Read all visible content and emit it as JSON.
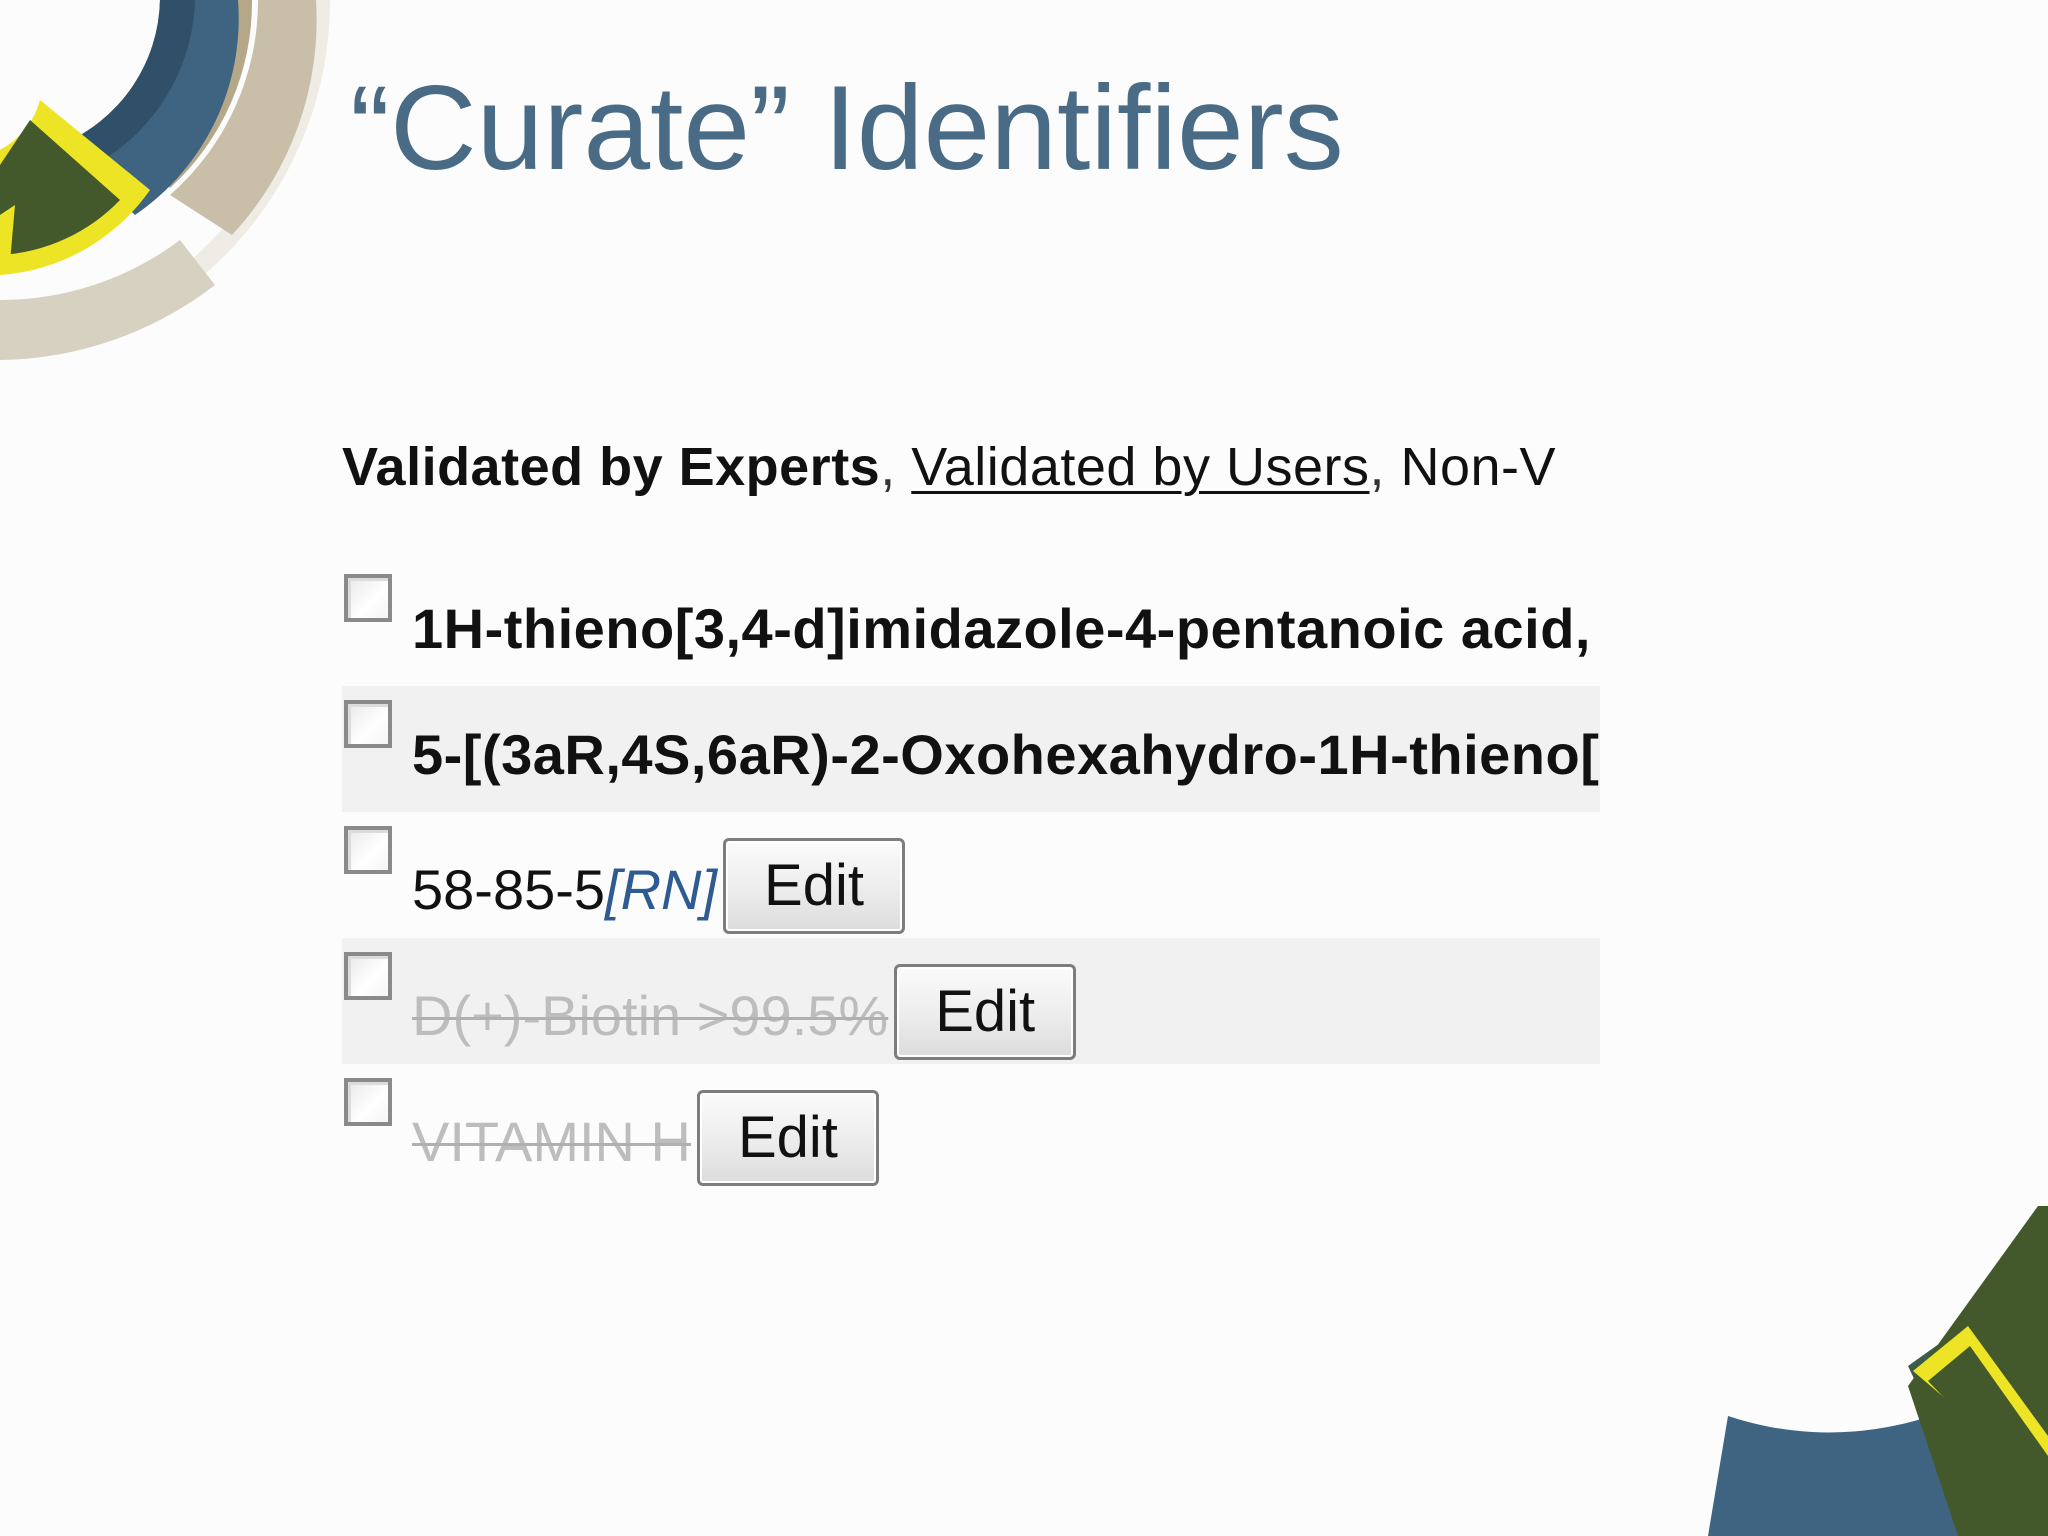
{
  "slide": {
    "title": "“Curate” Identifiers"
  },
  "filters": {
    "experts": "Validated by Experts",
    "sep1": ",",
    "users": "Validated by Users",
    "sep2": ",",
    "non_validated": "Non-V"
  },
  "identifiers": [
    {
      "text": "1H-thieno[3,4-d]imidazole-4-pentanoic acid,",
      "checked": false
    },
    {
      "text": "5-[(3aR,4S,6aR)-2-Oxohexahydro-1H-thieno[",
      "checked": false
    },
    {
      "text": "58-85-5",
      "tag": "[RN]",
      "edit_label": "Edit",
      "checked": false
    },
    {
      "text": "D(+)-Biotin >99.5%",
      "struck": true,
      "edit_label": "Edit",
      "checked": false
    },
    {
      "text": "VITAMIN H",
      "struck": true,
      "edit_label": "Edit",
      "checked": false
    }
  ],
  "colors": {
    "title": "#4a6b85",
    "struck_text": "#bdbdbd",
    "tag_text": "#2f5b93",
    "deco_blue": "#3f6481",
    "deco_green": "#43592b",
    "deco_yellow": "#ece424",
    "deco_beige": "#cfc8b6"
  }
}
